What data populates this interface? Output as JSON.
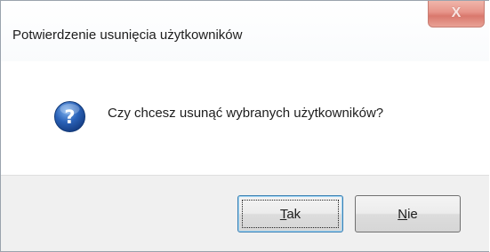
{
  "dialog": {
    "title": "Potwierdzenie usunięcia użytkowników",
    "close_label": "X",
    "message": "Czy chcesz usunąć wybranych użytkowników?",
    "icon": "question-icon"
  },
  "buttons": {
    "yes": {
      "mnemonic": "T",
      "rest": "ak"
    },
    "no": {
      "mnemonic": "N",
      "rest": "ie"
    }
  },
  "colors": {
    "close_button": "#e7958a",
    "icon_blue": "#2a62b8",
    "default_button_border": "#3c7fb1"
  }
}
